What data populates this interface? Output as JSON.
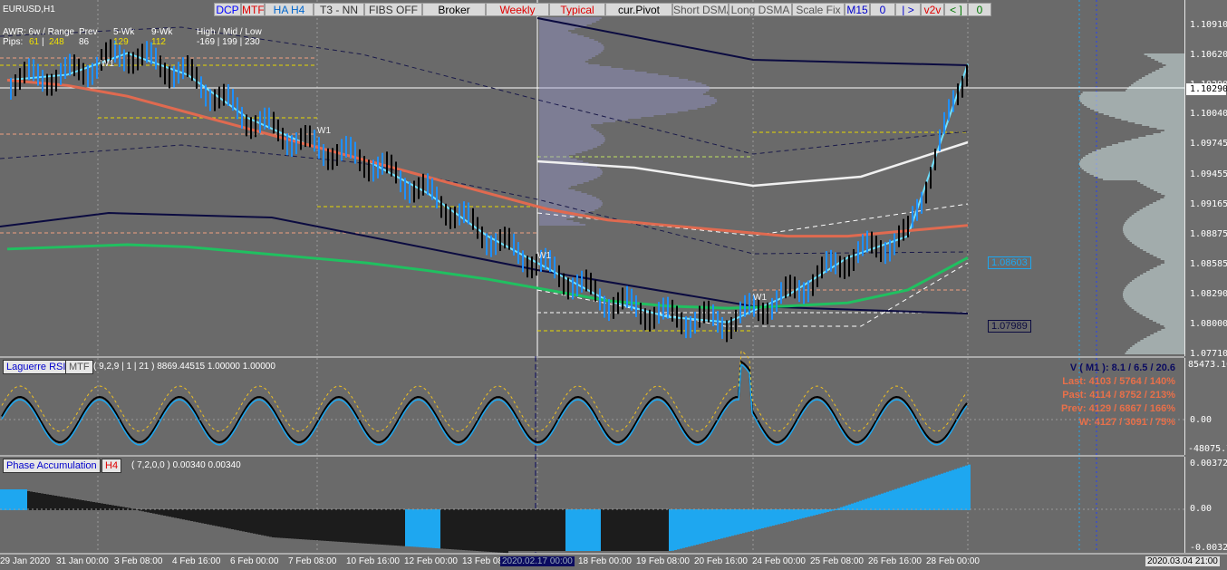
{
  "symbol": "EURUSD,H1",
  "colors": {
    "up_bar": "#1e90ff",
    "down_bar": "#000000",
    "bg": "#6a6a6a",
    "dsma_fast": "#f08080",
    "dsma_slow": "#20c060",
    "band": "#0b0b40",
    "pivot_yellow": "#e8d800",
    "phase_pos": "#1ea7f0",
    "phase_neg": "#1c1c1c"
  },
  "toolbar": [
    {
      "id": "dcp",
      "label": "DCP",
      "color": "#0000ff"
    },
    {
      "id": "mtf",
      "label": "MTF",
      "color": "#e00000"
    },
    {
      "id": "ha-h4",
      "label": "HA H4",
      "color": "#0066cc"
    },
    {
      "id": "t3-nn",
      "label": "T3 - NN",
      "color": "#333333"
    },
    {
      "id": "fibs-off",
      "label": "FIBS OFF",
      "color": "#333333"
    },
    {
      "id": "broker",
      "label": "Broker",
      "color": "#000000"
    },
    {
      "id": "weekly",
      "label": "Weekly",
      "color": "#e00000"
    },
    {
      "id": "typical",
      "label": "Typical",
      "color": "#e00000"
    },
    {
      "id": "cur-pivot",
      "label": "cur.Pivot",
      "color": "#000000"
    },
    {
      "id": "short-dsma",
      "label": "Short DSMA",
      "color": "#555555"
    },
    {
      "id": "long-dsma",
      "label": "Long DSMA",
      "color": "#555555"
    },
    {
      "id": "scale-fix",
      "label": "Scale Fix",
      "color": "#555555"
    },
    {
      "id": "m15",
      "label": "M15",
      "color": "#0000cc"
    },
    {
      "id": "zero",
      "label": "0",
      "color": "#0000cc"
    },
    {
      "id": "fwd",
      "label": "| >",
      "color": "#0000cc"
    },
    {
      "id": "v2v",
      "label": "v2v",
      "color": "#e00000"
    },
    {
      "id": "back",
      "label": "< ]",
      "color": "#007700"
    },
    {
      "id": "zero2",
      "label": "0",
      "color": "#007700"
    }
  ],
  "info": {
    "awr": "AWR: 6w / Range",
    "prev": "Prev",
    "wk5": "5-Wk",
    "wk9": "9-Wk",
    "hml": "High / Mid / Low",
    "pips_label": "Pips:",
    "pips_a": "61",
    "pips_sep": "|",
    "pips_b": "248",
    "prev_val": "86",
    "wk5_val": "129",
    "wk9_val": "112",
    "hml_val": "-169  |  199  |  230"
  },
  "week_labels": [
    "W1",
    "W1",
    "W1",
    "W1"
  ],
  "price_axis": [
    "1.10910",
    "1.10620",
    "1.10290",
    "1.10040",
    "1.09745",
    "1.09455",
    "1.09165",
    "1.08875",
    "1.08585",
    "1.08290",
    "1.08000",
    "1.07710"
  ],
  "price_current": "1.10290",
  "price_tags": [
    {
      "value": "1.08603"
    },
    {
      "value": "1.07989"
    }
  ],
  "time_axis": [
    "29 Jan 2020",
    "31 Jan 00:00",
    "3 Feb 08:00",
    "4 Feb 16:00",
    "6 Feb 00:00",
    "7 Feb 08:00",
    "10 Feb 16:00",
    "12 Feb 00:00",
    "13 Feb 08",
    "2020.02.17 00:00",
    "18 Feb 00:00",
    "19 Feb 08:00",
    "20 Feb 16:00",
    "24 Feb 00:00",
    "25 Feb 08:00",
    "26 Feb 16:00",
    "28 Feb 00:00"
  ],
  "time_corner": "2020.03.04 21:00",
  "laguerre": {
    "name": "Laguerre RSI",
    "tf": "MTF",
    "params": "( 9,2,9 | 1 | 21 ) 8869.44515 1.00000 1.00000",
    "axis": [
      "85473.162",
      "0.00",
      "-48075.730"
    ]
  },
  "stats": {
    "v": "V ( M1 ): 8.1 / 6.5 / 20.6",
    "last": "Last: 4103 / 5764 / 140%",
    "past": "Past: 4114 / 8752 / 213%",
    "prev": "Prev: 4129 / 6867 / 166%",
    "w": "W: 4127 / 3091 / 75%"
  },
  "phase": {
    "name": "Phase Accumulation",
    "tf": "H4",
    "params": "( 7,2,0,0 ) 0.00340 0.00340",
    "axis": [
      "0.00372",
      "0.00",
      "-0.00323"
    ]
  },
  "chart_data": {
    "type": "line",
    "title": "EURUSD,H1",
    "xlabel": "",
    "ylabel": "",
    "ylim": [
      1.0771,
      1.1091
    ],
    "x": [
      "29 Jan 2020",
      "31 Jan 00:00",
      "3 Feb 08:00",
      "4 Feb 16:00",
      "6 Feb 00:00",
      "7 Feb 08:00",
      "10 Feb 16:00",
      "12 Feb 00:00",
      "13 Feb 08:00",
      "17 Feb 00:00",
      "18 Feb 00:00",
      "19 Feb 08:00",
      "20 Feb 16:00",
      "24 Feb 00:00",
      "25 Feb 08:00",
      "26 Feb 16:00",
      "28 Feb 00:00"
    ],
    "series": [
      {
        "values": [
          1.1025,
          1.103,
          1.105,
          1.103,
          1.099,
          1.0965,
          1.095,
          1.092,
          1.088,
          1.085,
          1.082,
          1.0805,
          1.08,
          1.0825,
          1.086,
          1.088,
          1.104
        ]
      },
      {
        "values": [
          1.1025,
          1.102,
          1.101,
          1.0995,
          1.098,
          1.0965,
          1.095,
          1.0935,
          1.092,
          1.0905,
          1.0895,
          1.089,
          1.0885,
          1.088,
          1.088,
          1.0885,
          1.089
        ]
      },
      {
        "values": [
          1.0868,
          1.087,
          1.0872,
          1.087,
          1.0865,
          1.086,
          1.0855,
          1.0848,
          1.084,
          1.083,
          1.082,
          1.0815,
          1.0813,
          1.0815,
          1.0818,
          1.083,
          1.086
        ]
      }
    ]
  }
}
